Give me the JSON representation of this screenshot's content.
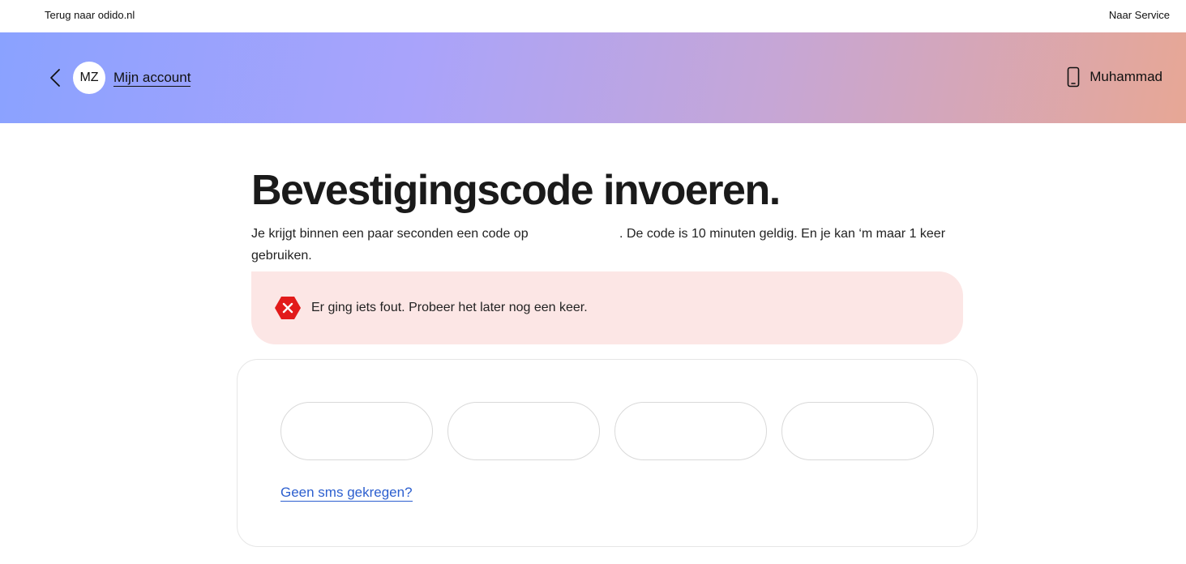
{
  "topbar": {
    "back_link": "Terug naar odido.nl",
    "service_link": "Naar Service"
  },
  "header": {
    "avatar_initials": "MZ",
    "account_label": "Mijn account",
    "user_name": "Muhammad",
    "gradient_colors": [
      "#8aa2ff",
      "#a9a3fb",
      "#c6a6d6",
      "#e7a795"
    ]
  },
  "main": {
    "title": "Bevestigingscode invoeren.",
    "desc_part1": "Je krijgt binnen een paar seconden een code op",
    "desc_part2": ". De code is 10 minuten geldig. En je kan ‘m maar 1 keer gebruiken."
  },
  "alert": {
    "icon": "error-x-icon",
    "message": "Er ging iets fout. Probeer het later nog een keer.",
    "color": "#e21a1a",
    "background": "#fce6e5"
  },
  "code_form": {
    "inputs": [
      "",
      "",
      "",
      ""
    ],
    "resend_label": "Geen sms gekregen?",
    "link_color": "#2c5fcf"
  }
}
